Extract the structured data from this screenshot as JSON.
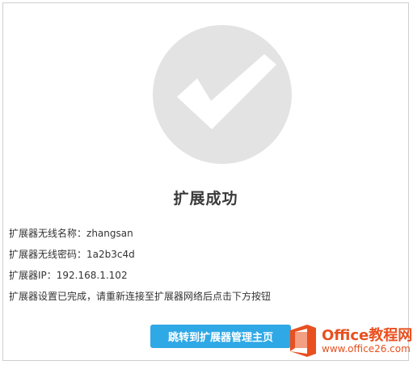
{
  "colors": {
    "accent_button": "#2fa8e6",
    "success_circle": "#e3e3e3",
    "check_mark": "#ffffff",
    "watermark": "#e8501f"
  },
  "status": {
    "icon": "checkmark-circle-icon",
    "title": "扩展成功"
  },
  "details": {
    "ssid_label": "扩展器无线名称：",
    "ssid_value": "zhangsan",
    "password_label": "扩展器无线密码：",
    "password_value": "1a2b3c4d",
    "ip_label": "扩展器IP：",
    "ip_value": "192.168.1.102",
    "instruction": "扩展器设置已完成，请重新连接至扩展器网络后点击下方按钮"
  },
  "actions": {
    "goto_management_label": "跳转到扩展器管理主页"
  },
  "watermark": {
    "icon": "office-logo-icon",
    "brand": "Office教程网",
    "url": "www.office26.com"
  }
}
